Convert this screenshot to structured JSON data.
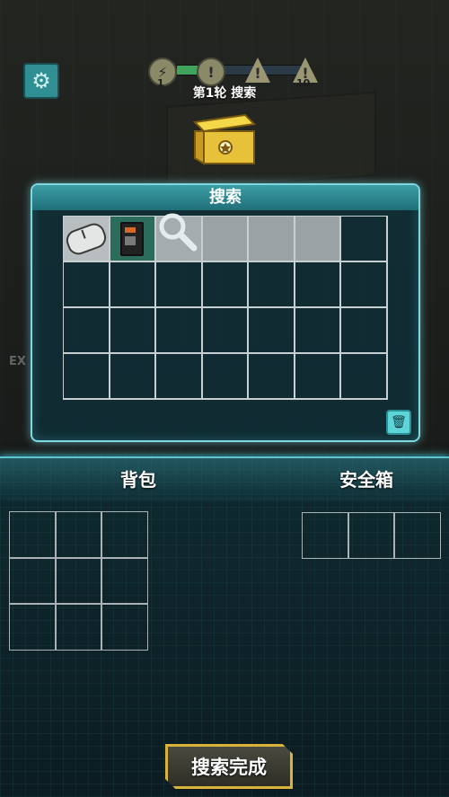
{
  "top": {
    "round_label": "第1轮 搜索",
    "nodes": [
      {
        "type": "circle",
        "number": "1"
      },
      {
        "type": "warning",
        "number": ""
      },
      {
        "type": "warning",
        "number": ""
      },
      {
        "type": "warning",
        "number": "10"
      }
    ],
    "progress_fraction": 0.22,
    "gear_icon": "gear-icon",
    "chest_icon": "treasure-chest-icon"
  },
  "search_panel": {
    "title": "搜索",
    "items": [
      {
        "name": "computer-mouse",
        "icon": "mouse-icon"
      },
      {
        "name": "circuit-chip",
        "icon": "chip-icon"
      }
    ],
    "trash_icon": "trash-icon"
  },
  "lower": {
    "backpack_title": "背包",
    "safe_title": "安全箱"
  },
  "done_button": {
    "label": "搜索完成"
  },
  "colors": {
    "accent": "#7fd8e0",
    "button_border": "#d9b43a",
    "panel_bg": "#0e303a"
  }
}
